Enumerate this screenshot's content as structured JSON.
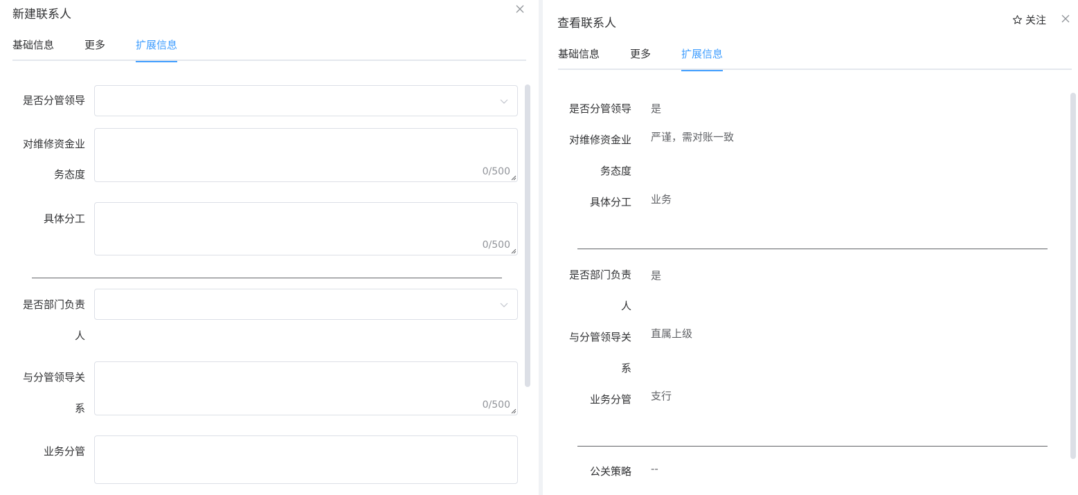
{
  "left_drawer": {
    "title": "新建联系人",
    "tabs": [
      {
        "label": "基础信息",
        "active": false
      },
      {
        "label": "更多",
        "active": false
      },
      {
        "label": "扩展信息",
        "active": true
      }
    ],
    "fields": {
      "supervisor_leader": {
        "label": "是否分管领导",
        "value": ""
      },
      "repair_fund_attitude": {
        "label_line1": "对维修资金业",
        "label_line2": "务态度",
        "value": "",
        "counter": "0/500"
      },
      "division_of_work": {
        "label": "具体分工",
        "value": "",
        "counter": "0/500"
      },
      "dept_head": {
        "label_line1": "是否部门负责",
        "label_line2": "人",
        "value": ""
      },
      "relation_to_leader": {
        "label_line1": "与分管领导关",
        "label_line2": "系",
        "value": "",
        "counter": "0/500"
      },
      "business_area": {
        "label": "业务分管",
        "value": ""
      }
    }
  },
  "right_drawer": {
    "title": "查看联系人",
    "follow_label": "关注",
    "tabs": [
      {
        "label": "基础信息",
        "active": false
      },
      {
        "label": "更多",
        "active": false
      },
      {
        "label": "扩展信息",
        "active": true
      }
    ],
    "fields": {
      "supervisor_leader": {
        "label": "是否分管领导",
        "value": "是"
      },
      "repair_fund_attitude": {
        "label_line1": "对维修资金业",
        "label_line2": "务态度",
        "value": "严谨，需对账一致"
      },
      "division_of_work": {
        "label": "具体分工",
        "value": "业务"
      },
      "dept_head": {
        "label_line1": "是否部门负责",
        "label_line2": "人",
        "value": "是"
      },
      "relation_to_leader": {
        "label_line1": "与分管领导关",
        "label_line2": "系",
        "value": "直属上级"
      },
      "business_area": {
        "label": "业务分管",
        "value": "支行"
      },
      "pr_strategy": {
        "label": "公关策略",
        "value": "--"
      }
    }
  },
  "colors": {
    "accent": "#409eff",
    "border": "#dcdfe6",
    "text": "#303133",
    "muted": "#909399"
  },
  "icons": {
    "close": "close-icon",
    "star": "star-outline-icon",
    "chevron": "chevron-down-icon",
    "resize": "resize-grip-icon"
  }
}
